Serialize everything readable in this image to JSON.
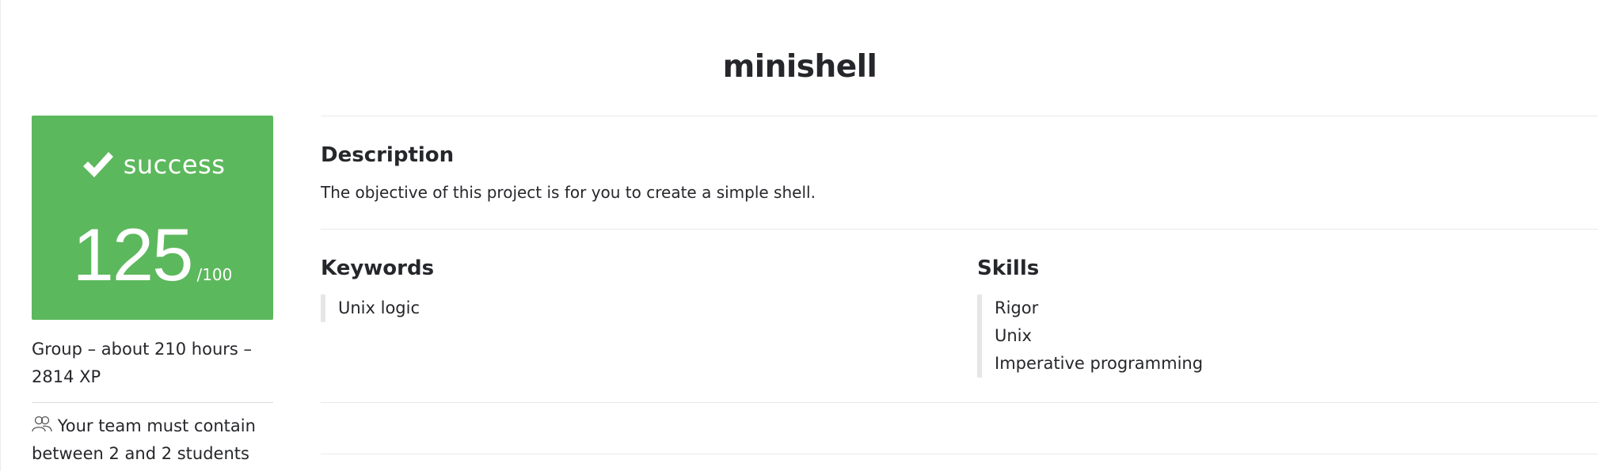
{
  "project": {
    "title": "minishell"
  },
  "status": {
    "label": "success",
    "icon": "check-icon",
    "score": "125",
    "max_score": "/100",
    "color": "#5cb85c"
  },
  "meta": {
    "line": "Group – about 210 hours – 2814 XP",
    "team_icon": "users-icon",
    "team_text": "Your team must contain between 2 and 2 students"
  },
  "description": {
    "heading": "Description",
    "text": "The objective of this project is for you to create a simple shell."
  },
  "keywords": {
    "heading": "Keywords",
    "items": [
      "Unix logic"
    ]
  },
  "skills": {
    "heading": "Skills",
    "items": [
      "Rigor",
      "Unix",
      "Imperative programming"
    ]
  }
}
